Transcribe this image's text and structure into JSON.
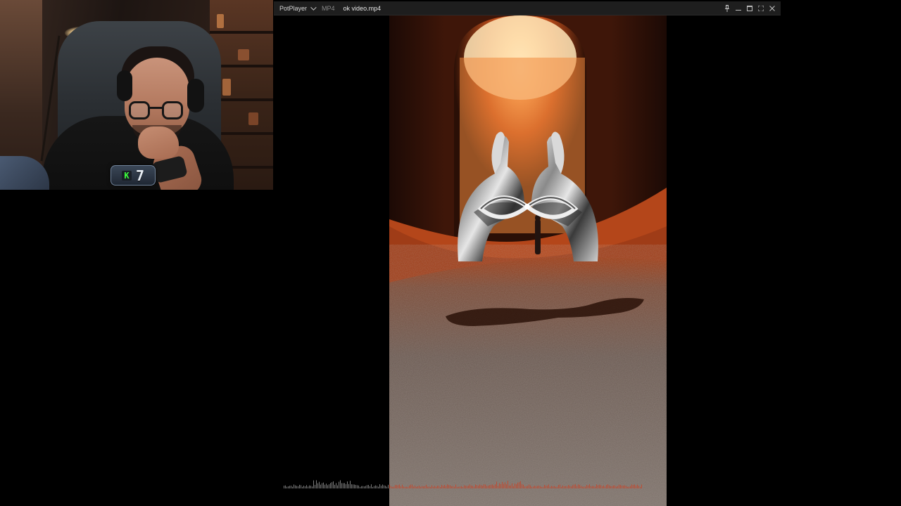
{
  "webcam": {
    "badge": {
      "key_letter": "K",
      "number": "7",
      "key_color": "#3cff3c"
    }
  },
  "player": {
    "menu_label": "PotPlayer",
    "format_label": "MP4",
    "filename": "ok video.mp4",
    "controls": [
      {
        "name": "pin-icon",
        "label": "pin"
      },
      {
        "name": "minimize-icon",
        "label": "minimize"
      },
      {
        "name": "maximize-icon",
        "label": "maximize"
      },
      {
        "name": "fullscreen-icon",
        "label": "fullscreen"
      },
      {
        "name": "close-icon",
        "label": "close"
      }
    ]
  },
  "video": {
    "scene": "chrome-hands-in-desert-tunnel",
    "accent": "#e0702a"
  },
  "visualizer": {
    "color_left": "#9a9a9a",
    "color_right": "#d23c1e"
  }
}
